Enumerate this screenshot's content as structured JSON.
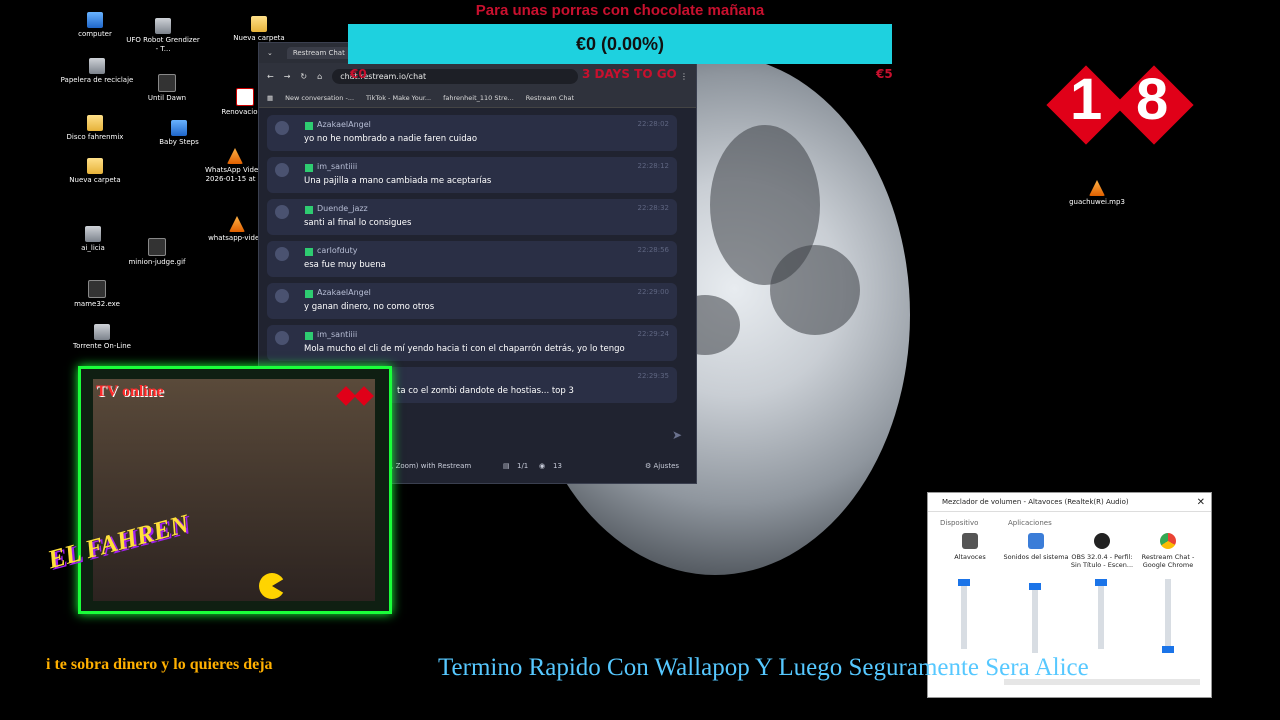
{
  "desktop": {
    "icons": [
      {
        "label": "computer"
      },
      {
        "label": "UFO Robot Grendizer - T..."
      },
      {
        "label": "Nueva carpeta"
      },
      {
        "label": "Papelera de reciclaje"
      },
      {
        "label": "Until Dawn"
      },
      {
        "label": "Renovacion..."
      },
      {
        "label": "Disco fahrenmix"
      },
      {
        "label": "Baby Steps"
      },
      {
        "label": "Nueva carpeta"
      },
      {
        "label": "WhatsApp Vide... 2026-01-15 at ..."
      },
      {
        "label": "ai_licia"
      },
      {
        "label": "whatsapp-vide..."
      },
      {
        "label": "minion-judge.gif"
      },
      {
        "label": "mame32.exe"
      },
      {
        "label": "Torrente On-Line"
      },
      {
        "label": "guachuwei.mp3"
      }
    ]
  },
  "banner": {
    "title": "Para unas porras con chocolate mañana",
    "amount": "€0 (0.00%)",
    "left": "€0",
    "middle": "3 DAYS TO GO",
    "right": "€5"
  },
  "browser": {
    "tab_title": "Restream Chat",
    "url": "chat.restream.io/chat",
    "bookmarks": [
      "New conversation -...",
      "TikTok - Make Your...",
      "fahrenheit_110 Stre...",
      "Restream Chat"
    ],
    "messages": [
      {
        "user": "AzakaelAngel",
        "time": "22:28:02",
        "text": "yo no he nombrado a nadie faren cuidao"
      },
      {
        "user": "im_santiiii",
        "time": "22:28:12",
        "text": "Una pajilla a mano cambiada me aceptarías"
      },
      {
        "user": "Duende_jazz",
        "time": "22:28:32",
        "text": "santi al final lo consigues"
      },
      {
        "user": "carlofduty",
        "time": "22:28:56",
        "text": "esa fue muy buena"
      },
      {
        "user": "AzakaelAngel",
        "time": "22:29:00",
        "text": "y ganan dinero, no como otros"
      },
      {
        "user": "im_santiiii",
        "time": "22:29:24",
        "text": "Mola mucho el cli de mí yendo hacia ti con el chaparrón detrás, yo lo tengo"
      },
      {
        "user": "",
        "time": "22:29:35",
        "text": "ta co el zombi dandote de hostias... top 3"
      }
    ],
    "footer": {
      "connect": "x, Zoom) with Restream",
      "pages": "1/1",
      "viewers": "13",
      "settings": "Ajustes"
    }
  },
  "overlay": {
    "tv_online": "TV online",
    "el_fahren": "EL FAHREN",
    "rating_1": "1",
    "rating_8": "8"
  },
  "mixer": {
    "title": "Mezclador de volumen - Altavoces (Realtek(R) Audio)",
    "device_header": "Dispositivo",
    "apps_header": "Aplicaciones",
    "columns": [
      {
        "label": "Altavoces",
        "level": 0.95
      },
      {
        "label": "Sonidos del sistema",
        "level": 0.95
      },
      {
        "label": "OBS 32.0.4 - Perfil: Sin Título - Escen...",
        "level": 0.95
      },
      {
        "label": "Restream Chat - Google Chrome",
        "level": 0.05
      }
    ]
  },
  "tickers": {
    "left": "i te sobra dinero y lo quieres deja",
    "right": "Termino Rapido Con Wallapop Y Luego Seguramente Sera Alice"
  }
}
